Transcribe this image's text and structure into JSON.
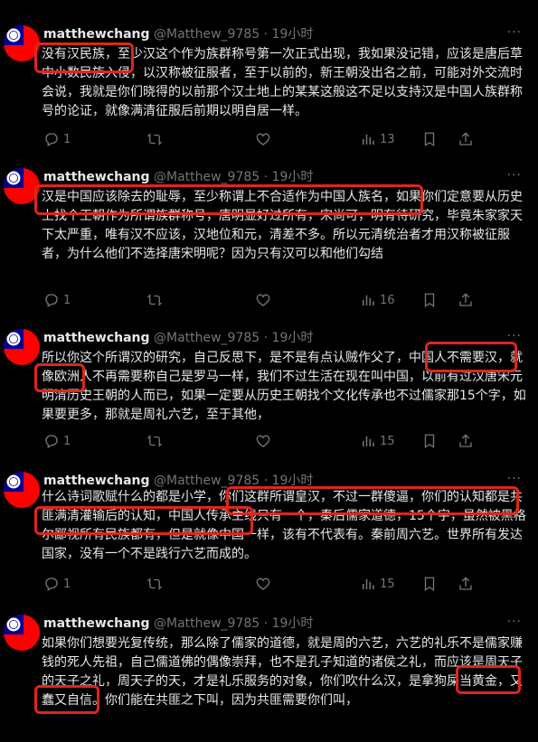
{
  "tweets": [
    {
      "name": "matthewchang",
      "handle": "@Matthew_9785",
      "dot": "·",
      "time": "19小时",
      "more": "···",
      "text": "没有汉民族，至少汉这个作为族群称号第一次正式出现，我如果没记错，应该是唐后草中小数民族入侵，以汉称被征服者，至于以前的，新王朝没出名之前，可能对外交流时会说，我就是你们晓得的以前那个汉土地上的某某这般这不足以支持汉是中国人族群称号的论证，就像满清征服后前期以明自居一样。",
      "replies": "1",
      "reposts": "",
      "likes": "",
      "views": "13"
    },
    {
      "name": "matthewchang",
      "handle": "@Matthew_9785",
      "dot": "·",
      "time": "19小时",
      "more": "···",
      "text": "汉是中国应该除去的耻辱，至少称谓上不合适作为中国人族名，如果你们定意要从历史上找个王朝作为所谓族群称号，唐明显好过所有，宋尚可，明有待研究，毕竟朱家家天下太严重，唯有汉不应该，汉地位和元，清差不多。所以元清统治者才用汉称被征服者，为什么他们不选择唐宋明呢？因为只有汉可以和他们勾结",
      "replies": "1",
      "reposts": "",
      "likes": "",
      "views": "16"
    },
    {
      "name": "matthewchang",
      "handle": "@Matthew_9785",
      "dot": "·",
      "time": "19小时",
      "more": "···",
      "text": "所以你这个所谓汉的研究，自己反思下，是不是有点认贼作父了，中国人不需要汉，就像欧洲人不再需要称自己是罗马一样，我们不过生活在现在叫中国，以前有过汉唐宋元明清历史王朝的人而已，如果一定要从历史王朝找个文化传承也不过儒家那15个字，如果要更多，那就是周礼六艺，至于其他，",
      "replies": "1",
      "reposts": "",
      "likes": "",
      "views": "15"
    },
    {
      "name": "matthewchang",
      "handle": "@Matthew_9785",
      "dot": "·",
      "time": "19小时",
      "more": "···",
      "text": "什么诗词歌赋什么的都是小学，你们这群所谓皇汉，不过一群傻逼，你们的认知都是共匪满清灌输后的认知，中国人传承主线只有一个，秦后儒家道德，15个字，虽然被黑格尔鄙视所有民族都有，但是就像中国一样，该有不代表有。秦前周六艺。世界所有发达国家，没有一个不是践行六艺而成的。",
      "replies": "1",
      "reposts": "",
      "likes": "",
      "views": "15"
    },
    {
      "name": "matthewchang",
      "handle": "@Matthew_9785",
      "dot": "·",
      "time": "19小时",
      "more": "···",
      "text": "如果你们想要光复传统，那么除了儒家的道德，就是周的六艺，六艺的礼乐不是儒家赚钱的死人先祖，自己儒道佛的偶像崇拜，也不是孔子知道的诸侯之礼，而应该是周天子的天子之礼，周天子的天，才是礼乐服务的对象，你们吹什么汉，是拿狗屎当黄金，又蠢又自信。你们能在共匪之下叫，因为共匪需要你们叫，",
      "replies": "",
      "reposts": "",
      "likes": "",
      "views": ""
    }
  ],
  "colors": {
    "highlight": "#e0251b",
    "text": "#e7e9ea",
    "muted": "#71767b",
    "flag_red": "#fe0000",
    "flag_blue": "#000095"
  },
  "icons": {
    "avatar": "taiwan-flag-icon",
    "reply": "reply-icon",
    "repost": "repost-icon",
    "like": "like-icon",
    "views": "views-icon",
    "bookmark": "bookmark-icon",
    "share": "share-icon"
  }
}
